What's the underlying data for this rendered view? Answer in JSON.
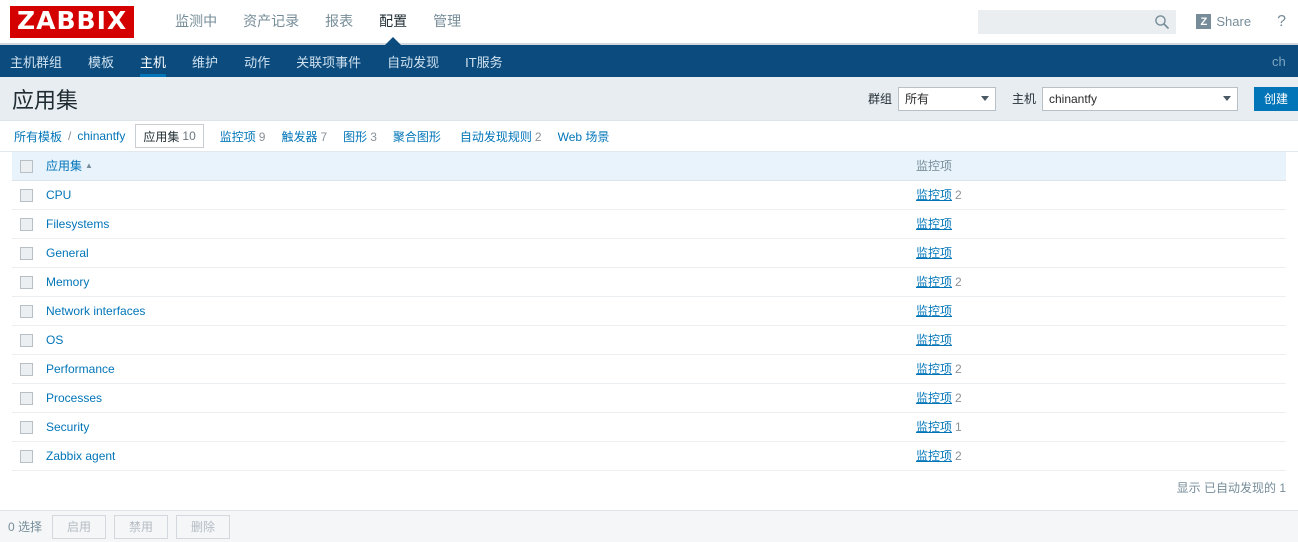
{
  "header": {
    "logo": "ZABBIX",
    "nav": [
      {
        "label": "监测中",
        "active": false
      },
      {
        "label": "资产记录",
        "active": false
      },
      {
        "label": "报表",
        "active": false
      },
      {
        "label": "配置",
        "active": true
      },
      {
        "label": "管理",
        "active": false
      }
    ],
    "search_placeholder": "",
    "search_value": "",
    "search_icon": "search-icon",
    "share_label": "Share",
    "share_icon": "zabbix-z-icon",
    "help_label": "?"
  },
  "subnav": {
    "items": [
      {
        "label": "主机群组",
        "active": false
      },
      {
        "label": "模板",
        "active": false
      },
      {
        "label": "主机",
        "active": true
      },
      {
        "label": "维护",
        "active": false
      },
      {
        "label": "动作",
        "active": false
      },
      {
        "label": "关联项事件",
        "active": false
      },
      {
        "label": "自动发现",
        "active": false
      },
      {
        "label": "IT服务",
        "active": false
      }
    ],
    "user": "ch"
  },
  "page": {
    "title": "应用集",
    "group_label": "群组",
    "group_value": "所有",
    "host_label": "主机",
    "host_value": "chinantfy",
    "create_button": "创建"
  },
  "breadcrumb": {
    "root": "所有模板",
    "separator": "/",
    "host": "chinantfy",
    "tabs": [
      {
        "label": "应用集",
        "count": "10",
        "selected": true
      },
      {
        "label": "监控项",
        "count": "9",
        "selected": false
      },
      {
        "label": "触发器",
        "count": "7",
        "selected": false
      },
      {
        "label": "图形",
        "count": "3",
        "selected": false
      },
      {
        "label": "聚合图形",
        "count": "",
        "selected": false
      },
      {
        "label": "自动发现规则",
        "count": "2",
        "selected": false
      },
      {
        "label": "Web 场景",
        "count": "",
        "selected": false
      }
    ]
  },
  "table": {
    "columns": {
      "name": "应用集",
      "sort_arrow": "▲",
      "items": "监控项"
    },
    "rows": [
      {
        "name": "CPU",
        "items_label": "监控项",
        "items_count": "2"
      },
      {
        "name": "Filesystems",
        "items_label": "监控项",
        "items_count": ""
      },
      {
        "name": "General",
        "items_label": "监控项",
        "items_count": ""
      },
      {
        "name": "Memory",
        "items_label": "监控项",
        "items_count": "2"
      },
      {
        "name": "Network interfaces",
        "items_label": "监控项",
        "items_count": ""
      },
      {
        "name": "OS",
        "items_label": "监控项",
        "items_count": ""
      },
      {
        "name": "Performance",
        "items_label": "监控项",
        "items_count": "2"
      },
      {
        "name": "Processes",
        "items_label": "监控项",
        "items_count": "2"
      },
      {
        "name": "Security",
        "items_label": "监控项",
        "items_count": "1"
      },
      {
        "name": "Zabbix agent",
        "items_label": "监控项",
        "items_count": "2"
      }
    ],
    "footer": "显示 已自动发现的 1"
  },
  "actionbar": {
    "selected_count": "0 选择",
    "buttons": [
      {
        "label": "启用"
      },
      {
        "label": "禁用"
      },
      {
        "label": "删除"
      }
    ]
  },
  "colors": {
    "brand_red": "#d40000",
    "nav_dark": "#0c4b7d",
    "link_blue": "#0275b8",
    "header_row": "#e8f3fc",
    "page_header": "#e8edf1"
  }
}
